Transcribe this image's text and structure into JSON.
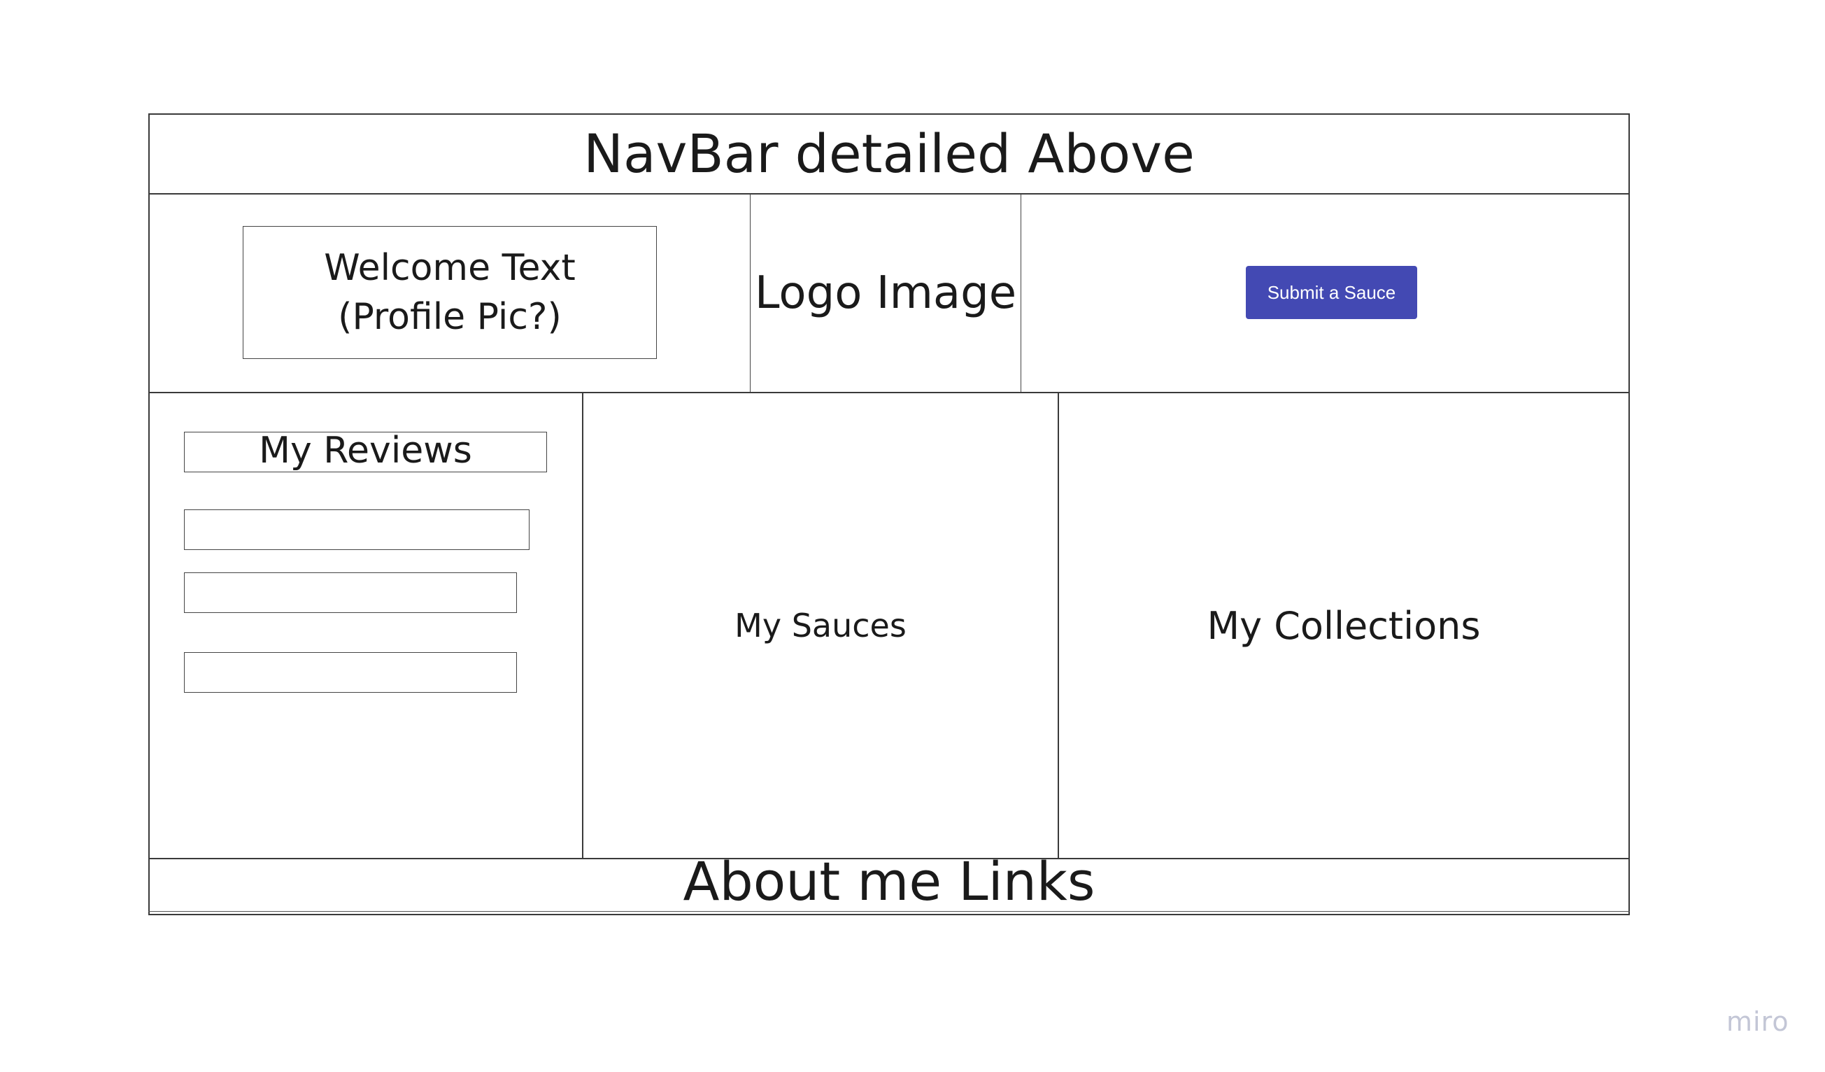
{
  "navbar": {
    "label": "NavBar detailed Above"
  },
  "header_row": {
    "welcome_text": "Welcome Text (Profile Pic?)",
    "logo_label": "Logo Image",
    "submit_button_label": "Submit a Sauce"
  },
  "content": {
    "reviews_title": "My Reviews",
    "review_items": [
      "",
      "",
      ""
    ],
    "sauces_label": "My Sauces",
    "collections_label": "My Collections"
  },
  "footer": {
    "label": "About me Links"
  },
  "watermark": {
    "label": "miro"
  },
  "colors": {
    "button_bg": "#4349b3",
    "button_text": "#ffffff",
    "border": "#3a3a3a",
    "watermark": "#c3c6d6"
  }
}
